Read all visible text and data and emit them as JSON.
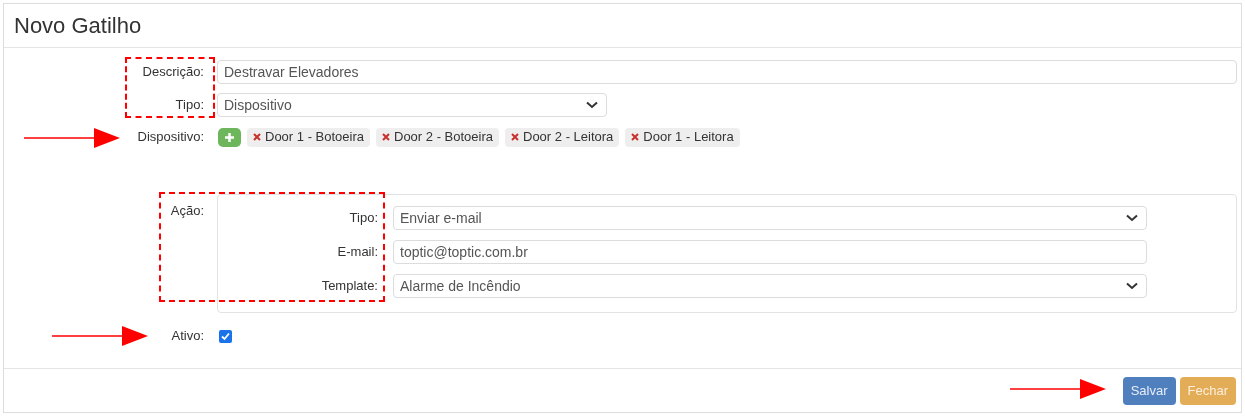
{
  "title": "Novo Gatilho",
  "descricao": {
    "label": "Descrição:",
    "value": "Destravar Elevadores"
  },
  "tipo": {
    "label": "Tipo:",
    "value": "Dispositivo"
  },
  "dispositivo": {
    "label": "Dispositivo:",
    "tags": [
      "Door 1 - Botoeira",
      "Door 2 - Botoeira",
      "Door 2 - Leitora",
      "Door 1 - Leitora"
    ]
  },
  "acao": {
    "label": "Ação:",
    "fields": [
      {
        "kind": "select",
        "label": "Tipo:",
        "value": "Enviar e-mail"
      },
      {
        "kind": "input",
        "label": "E-mail:",
        "value": "toptic@toptic.com.br"
      },
      {
        "kind": "select",
        "label": "Template:",
        "value": "Alarme de Incêndio"
      }
    ]
  },
  "ativo": {
    "label": "Ativo:",
    "checked": true
  },
  "buttons": [
    {
      "label": "Salvar",
      "kind": "primary"
    },
    {
      "label": "Fechar",
      "kind": "warning"
    }
  ]
}
